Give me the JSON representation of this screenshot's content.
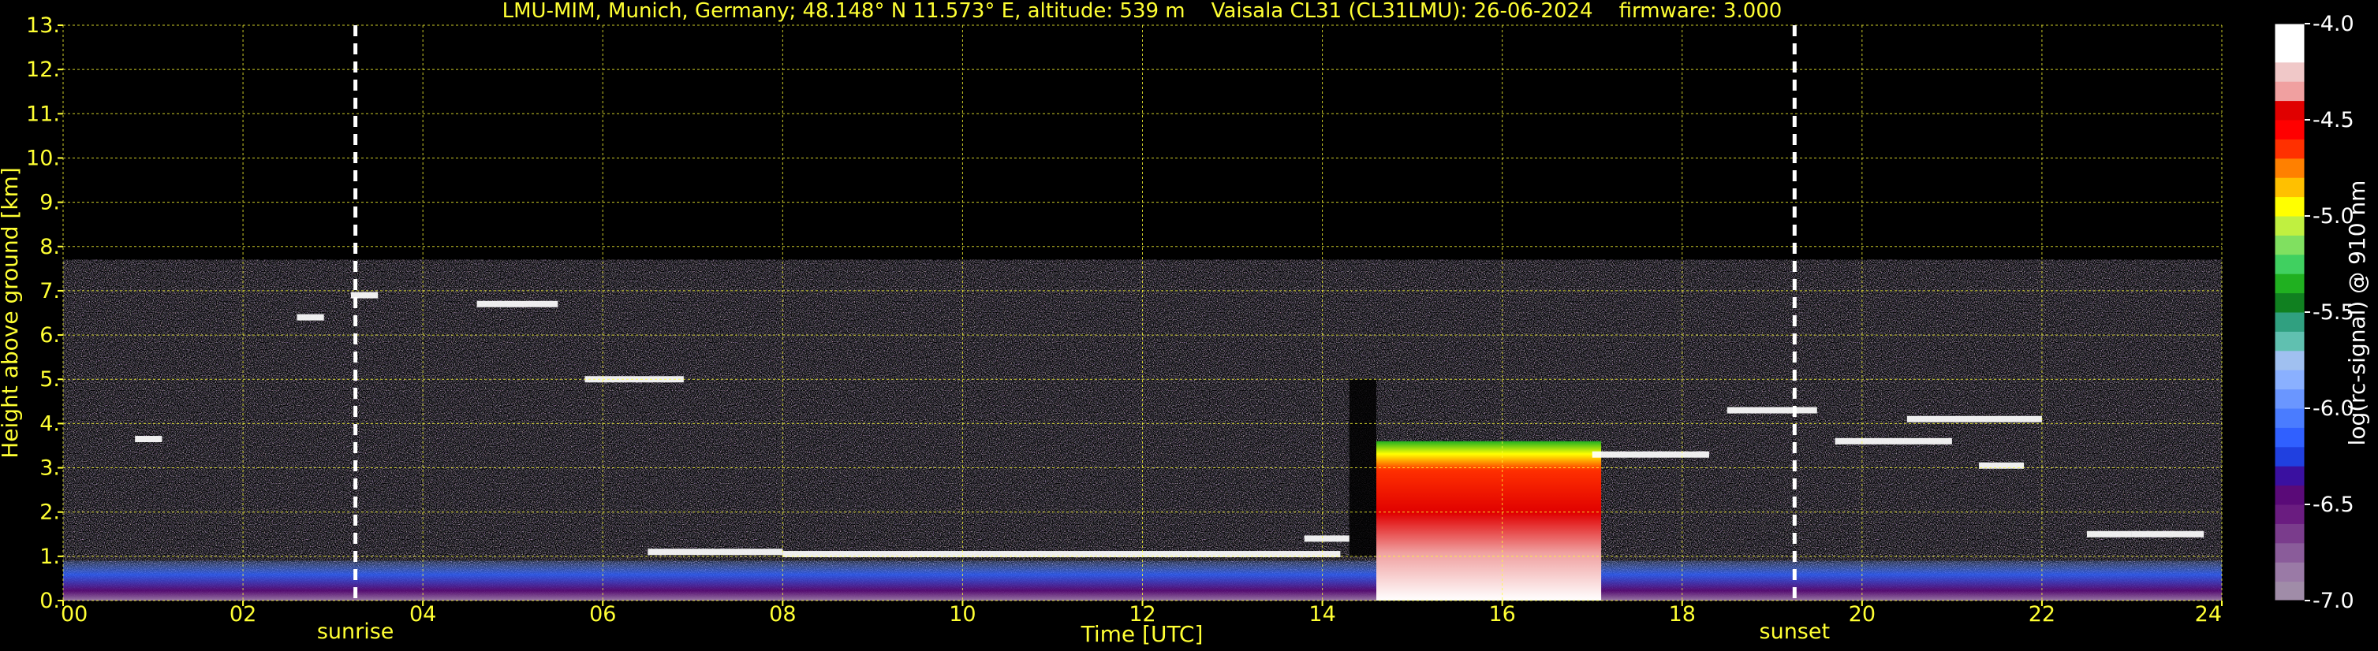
{
  "chart_data": {
    "type": "heatmap",
    "title": "LMU-MIM, Munich, Germany; 48.148° N 11.573° E, altitude: 539 m    Vaisala CL31 (CL31LMU): 26-06-2024    firmware: 3.000",
    "xlabel": "Time [UTC]",
    "ylabel": "Height above ground [km]",
    "xlim": [
      0,
      24
    ],
    "ylim": [
      0,
      13
    ],
    "x_ticks": [
      "00",
      "02",
      "04",
      "06",
      "08",
      "10",
      "12",
      "14",
      "16",
      "18",
      "20",
      "22",
      "24"
    ],
    "y_ticks": [
      "0.",
      "1.",
      "2.",
      "3.",
      "4.",
      "5.",
      "6.",
      "7.",
      "8.",
      "9.",
      "10.",
      "11.",
      "12.",
      "13."
    ],
    "grid": true,
    "colorbar": {
      "label": "log(rc-signal) @ 910 nm",
      "range": [
        -7.0,
        -4.0
      ],
      "ticks": [
        "-4.0",
        "-4.5",
        "-5.0",
        "-5.5",
        "-6.0",
        "-6.5",
        "-7.0"
      ],
      "colors": [
        "#a08ca8",
        "#9a7aa6",
        "#8a5c9a",
        "#7a3c8c",
        "#6a1c80",
        "#5a0a78",
        "#3a10a0",
        "#2040e0",
        "#3060ff",
        "#4a7cff",
        "#6a96ff",
        "#8ab0ff",
        "#a0c0f0",
        "#60c0b0",
        "#30a080",
        "#108020",
        "#20b020",
        "#40d060",
        "#80e060",
        "#c0f040",
        "#ffff00",
        "#ffc000",
        "#ff8000",
        "#ff3000",
        "#ff0000",
        "#e00000",
        "#f0a0a0",
        "#f0c8c8",
        "#ffffff",
        "#ffffff"
      ]
    },
    "markers": [
      {
        "label": "sunrise",
        "time": 3.25
      },
      {
        "label": "sunset",
        "time": 19.25
      }
    ],
    "features": {
      "noise_top_km": 7.7,
      "boundary_layer_km": 0.9,
      "cloud_segments": [
        {
          "t0": 0.8,
          "t1": 1.1,
          "h": 3.65
        },
        {
          "t0": 2.6,
          "t1": 2.9,
          "h": 6.4
        },
        {
          "t0": 3.2,
          "t1": 3.5,
          "h": 6.9
        },
        {
          "t0": 4.6,
          "t1": 5.5,
          "h": 6.7
        },
        {
          "t0": 5.8,
          "t1": 6.9,
          "h": 5.0
        },
        {
          "t0": 6.5,
          "t1": 8.0,
          "h": 1.1
        },
        {
          "t0": 8.0,
          "t1": 14.2,
          "h": 1.05
        },
        {
          "t0": 13.8,
          "t1": 14.3,
          "h": 1.4
        },
        {
          "t0": 17.0,
          "t1": 18.3,
          "h": 3.3
        },
        {
          "t0": 18.5,
          "t1": 19.5,
          "h": 4.3
        },
        {
          "t0": 19.7,
          "t1": 21.0,
          "h": 3.6
        },
        {
          "t0": 20.5,
          "t1": 22.0,
          "h": 4.1
        },
        {
          "t0": 21.3,
          "t1": 21.8,
          "h": 3.05
        },
        {
          "t0": 22.5,
          "t1": 23.0,
          "h": 1.5
        },
        {
          "t0": 23.0,
          "t1": 23.8,
          "h": 1.5
        }
      ],
      "convective_cloud": {
        "t0": 14.6,
        "t1": 17.1,
        "base_km": 0.0,
        "top_km": 3.6
      },
      "clear_gap": {
        "t0": 14.3,
        "t1": 14.6
      }
    }
  }
}
